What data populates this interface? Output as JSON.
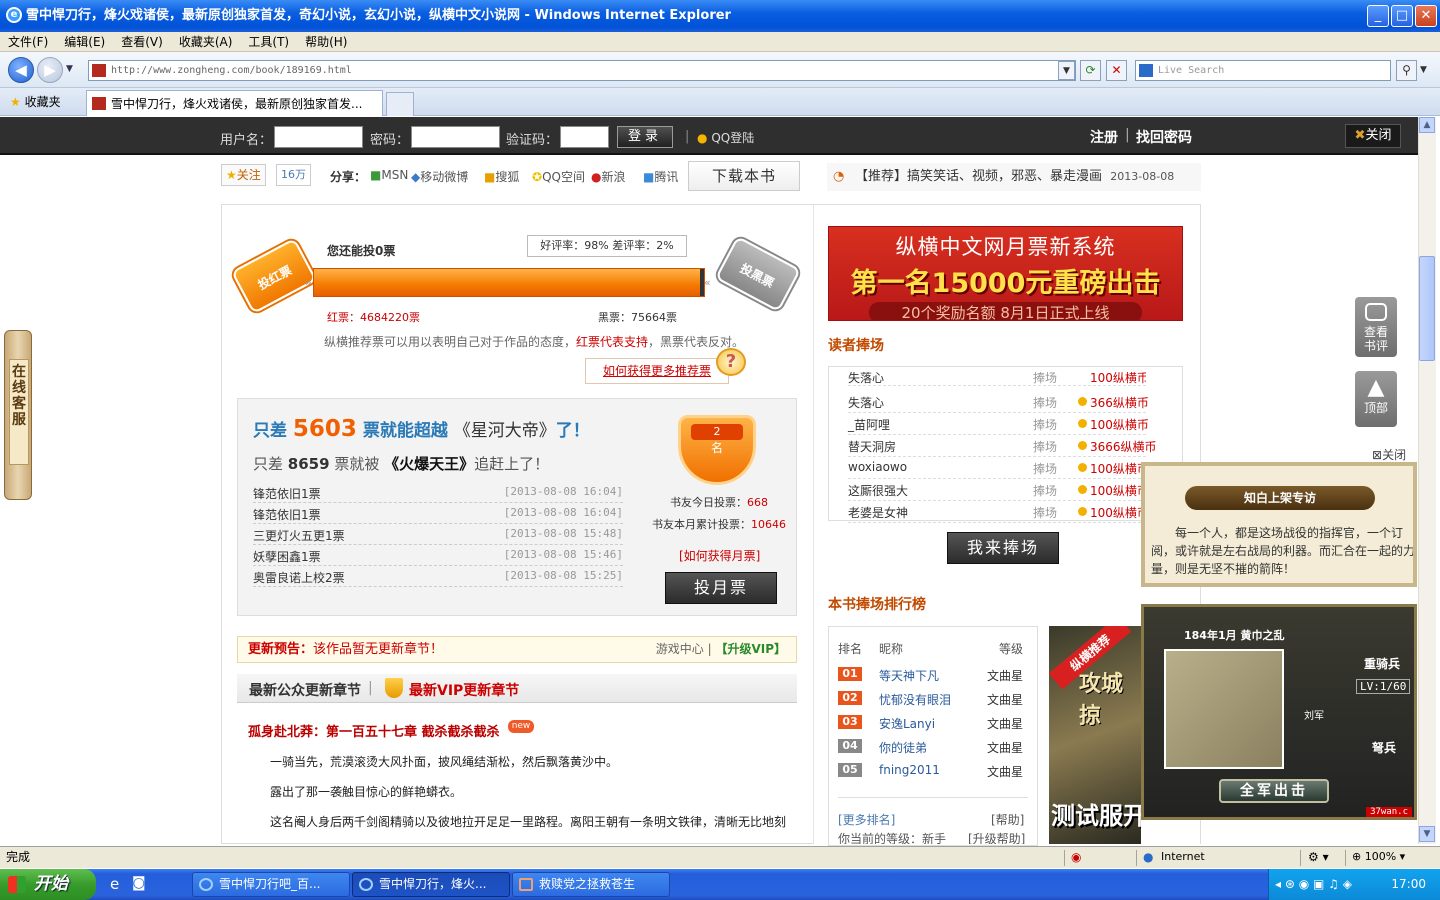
{
  "window": {
    "title": "雪中悍刀行，烽火戏诸侯，最新原创独家首发，奇幻小说，玄幻小说，纵横中文小说网 - Windows Internet Explorer"
  },
  "menu": [
    "文件(F)",
    "编辑(E)",
    "查看(V)",
    "收藏夹(A)",
    "工具(T)",
    "帮助(H)"
  ],
  "address": {
    "url": "http://www.zongheng.com/book/189169.html",
    "search_placeholder": "Live Search"
  },
  "favorites_label": "收藏夹",
  "tab_title": "雪中悍刀行，烽火戏诸侯，最新原创独家首发...",
  "login": {
    "user_label": "用户名：",
    "pass_label": "密码：",
    "captcha_label": "验证码：",
    "login_btn": "登录",
    "qq_login": "QQ登陆",
    "register": "注册",
    "sep": "|",
    "recover": "找回密码",
    "close": "关闭"
  },
  "share": {
    "follow": "关注",
    "follow_count": "16万",
    "label": "分享：",
    "items": [
      "MSN",
      "移动微博",
      "搜狐",
      "QQ空间",
      "新浪",
      "腾讯"
    ],
    "download": "下载本书",
    "recommend": "【推荐】搞笑笑话、视频，邪恶、暴走漫画",
    "recommend_date": "2013-08-08"
  },
  "vote": {
    "can_vote": "您还能投0票",
    "rate": "好评率：98%  差评率：2%",
    "red_ticket": "投红票",
    "black_ticket": "投黑票",
    "red_label": "红票：",
    "red_count": "4684220票",
    "black_label": "黑票：",
    "black_count": "75664票",
    "red_share": 0.984,
    "note_a": "纵横推荐票可以用以表明自己对于作品的态度，",
    "note_red": "红票代表支持",
    "note_b": "，黑票代表反对。",
    "how_more": "如何获得更多推荐票"
  },
  "month": {
    "gap1_a": "只差",
    "gap1_num": "5603",
    "gap1_b": "票就能超越",
    "gap1_book": "《星河大帝》",
    "gap1_c": "了！",
    "gap2_a": "只差",
    "gap2_num": "8659",
    "gap2_b": "票就被",
    "gap2_book": "《火爆天王》",
    "gap2_c": "追赶上了！",
    "rows": [
      {
        "name": "锋范依旧1票",
        "time": "[2013-08-08 16:04]"
      },
      {
        "name": "锋范依旧1票",
        "time": "[2013-08-08 16:04]"
      },
      {
        "name": "三更灯火五更1票",
        "time": "[2013-08-08 15:48]"
      },
      {
        "name": "妖孽困鑫1票",
        "time": "[2013-08-08 15:46]"
      },
      {
        "name": "奥雷良诺上校2票",
        "time": "[2013-08-08 15:25]"
      }
    ],
    "rank_top": "2",
    "rank_unit": "名",
    "today_label": "书友今日投票：",
    "today_count": "668",
    "month_label": "书友本月累计投票：",
    "month_count": "10646",
    "how_month": "[如何获得月票]",
    "vote_btn": "投月票"
  },
  "notice": {
    "title": "更新预告：",
    "text": "该作品暂无更新章节！",
    "game": "游戏中心",
    "sep": "|",
    "vip": "【升级VIP】"
  },
  "chapter": {
    "tab_public": "最新公众更新章节",
    "tab_sep": "|",
    "tab_vip": "最新VIP更新章节",
    "title": "孤身赴北莽：第一百五十七章 截杀截杀截杀",
    "new_badge": "new",
    "p1": "一骑当先，荒漠滚烫大风扑面，披风绳结渐松，然后飘落黄沙中。",
    "p2": "露出了那一袭触目惊心的鲜艳蟒衣。",
    "p3": "这名阉人身后两千剑阁精骑以及彼地拉开足足一里路程。离阳王朝有一条明文铁律，清晰无比地刻"
  },
  "banner": {
    "line1": "纵横中文网月票新系统",
    "line2": "第一名15000元重磅出击",
    "line3": "20个奖励名额 8月1日正式上线"
  },
  "praise": {
    "title": "读者捧场",
    "rows": [
      {
        "user": "失落心",
        "action": "捧场",
        "coins": "100纵横币"
      },
      {
        "user": "失落心",
        "action": "捧场",
        "coins": "366纵横币"
      },
      {
        "user": "_苗阿哩",
        "action": "捧场",
        "coins": "100纵横币"
      },
      {
        "user": "替天洞房",
        "action": "捧场",
        "coins": "3666纵横币"
      },
      {
        "user": "woxiaowo",
        "action": "捧场",
        "coins": "100纵横币"
      },
      {
        "user": "这厮很强大",
        "action": "捧场",
        "coins": "100纵横币"
      },
      {
        "user": "老婆是女神",
        "action": "捧场",
        "coins": "100纵横币"
      }
    ],
    "btn": "我来捧场"
  },
  "ranking": {
    "title": "本书捧场排行榜",
    "col_rank": "排名",
    "col_nick": "昵称",
    "col_level": "等级",
    "rows": [
      {
        "no": "01",
        "nick": "等天神下凡",
        "level": "文曲星"
      },
      {
        "no": "02",
        "nick": "忧郁没有眼泪",
        "level": "文曲星"
      },
      {
        "no": "03",
        "nick": "安逸Lanyi",
        "level": "文曲星"
      },
      {
        "no": "04",
        "nick": "你的徒弟",
        "level": "文曲星"
      },
      {
        "no": "05",
        "nick": "fning2011",
        "level": "文曲星"
      }
    ],
    "more": "[更多排名]",
    "help": "[帮助]",
    "current": "你当前的等级：新手",
    "upgrade": "[升级帮助]"
  },
  "side_banner": {
    "tag": "纵横推荐",
    "name": "攻城掠",
    "bottom": "测试服开"
  },
  "popup": {
    "close": "关闭",
    "title": "知白上架专访",
    "text": "每一个人，都是这场战役的指挥官，一个订阅，或许就是左右战局的利器。而汇合在一起的力量，则是无坚不摧的箭阵！",
    "game_date": "184年1月 黄巾之乱",
    "cavalry": "重骑兵",
    "level": "LV:1/60",
    "general": "刘军",
    "infantry": "弩兵",
    "go": "全军出击",
    "brand": "37wan.c"
  },
  "float_buttons": {
    "comment": "查看书评",
    "top": "顶部"
  },
  "service": "在线客服",
  "status": {
    "done": "完成",
    "zone": "Internet",
    "zoom": "100%"
  },
  "taskbar": {
    "start": "开始",
    "tasks": [
      "雪中悍刀行吧_百...",
      "雪中悍刀行，烽火...",
      "救赎党之拯救苍生"
    ],
    "clock": "17:00"
  }
}
